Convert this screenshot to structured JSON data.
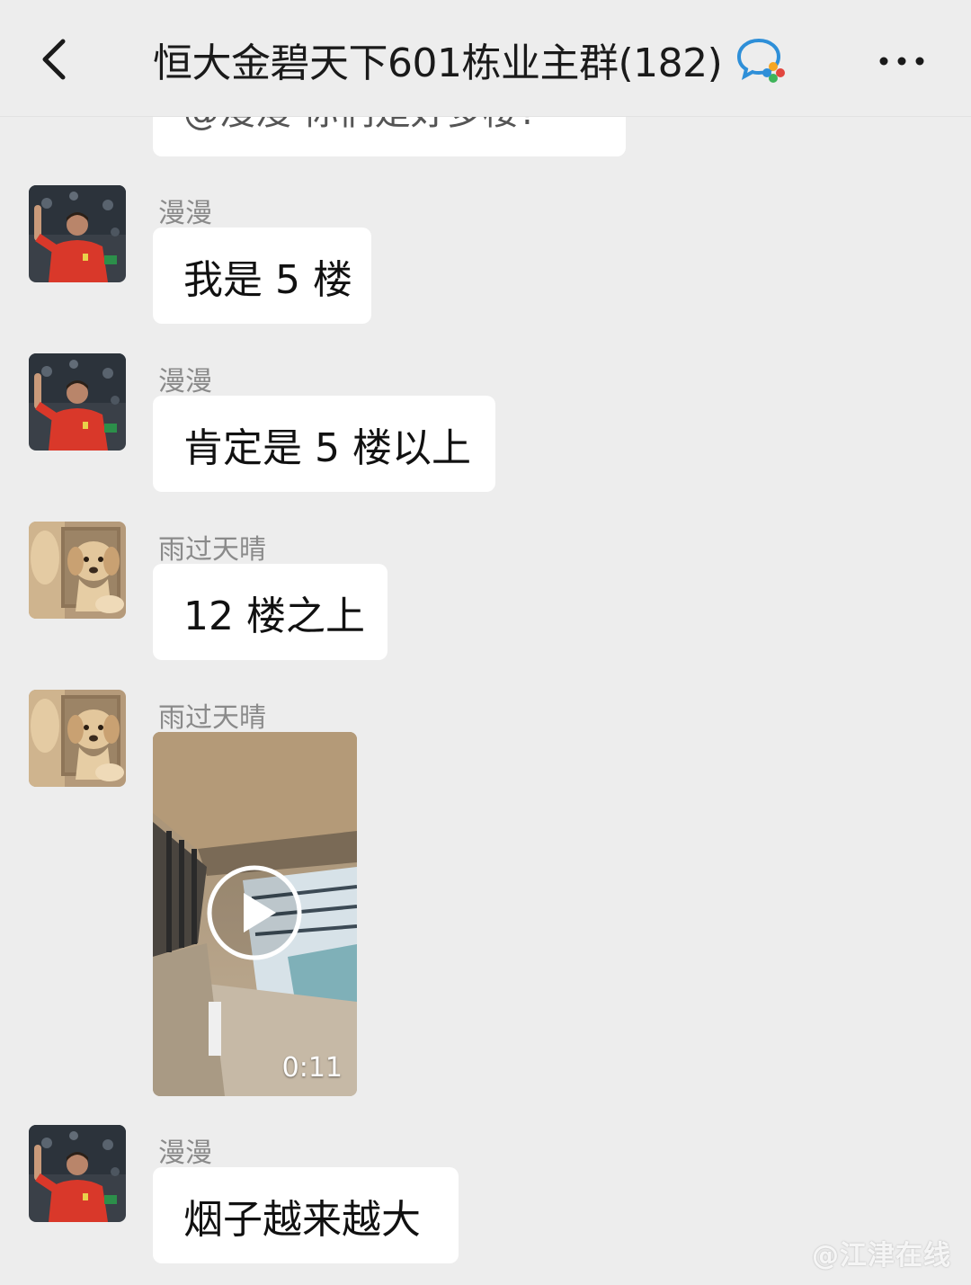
{
  "header": {
    "title": "恒大金碧天下601栋业主群(182)",
    "back_icon": "chevron-left-icon",
    "enterprise_icon": "enterprise-wechat-icon",
    "more_icon": "more-dots-icon"
  },
  "partial_message": {
    "text": "@漫漫 你们是好多楼?"
  },
  "messages": [
    {
      "sender": "漫漫",
      "text": "我是 5 楼",
      "avatar": "goalkeeper-avatar"
    },
    {
      "sender": "漫漫",
      "text": "肯定是 5 楼以上",
      "avatar": "goalkeeper-avatar"
    },
    {
      "sender": "雨过天晴",
      "text": "12 楼之上",
      "avatar": "puppy-avatar"
    },
    {
      "sender": "雨过天晴",
      "video_duration": "0:11",
      "avatar": "puppy-avatar"
    },
    {
      "sender": "漫漫",
      "text": "烟子越来越大",
      "avatar": "goalkeeper-avatar"
    }
  ],
  "watermark": "@江津在线",
  "colors": {
    "background": "#ededed",
    "bubble": "#ffffff",
    "sender_name": "#8a8a8a",
    "goalkeeper_shirt": "#d9382a",
    "puppy_fur": "#d9b585"
  }
}
